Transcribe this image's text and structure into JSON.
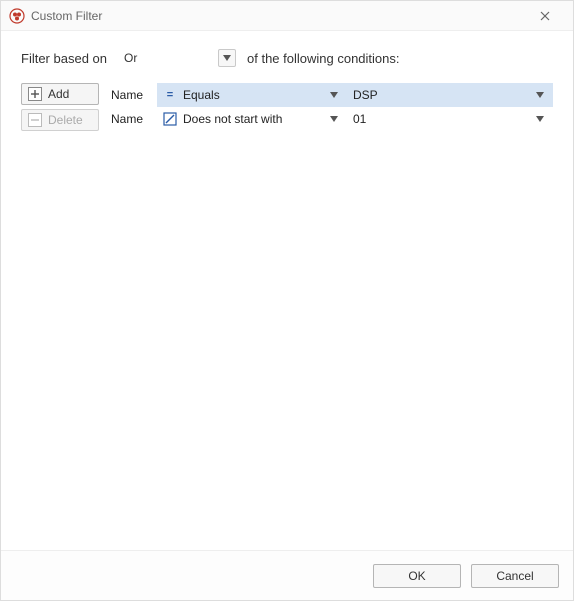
{
  "window": {
    "title": "Custom Filter"
  },
  "filter": {
    "prefix_label": "Filter based on",
    "logic": "Or",
    "suffix_label": "of the following conditions:"
  },
  "side": {
    "add_label": "Add",
    "delete_label": "Delete"
  },
  "rows": [
    {
      "field": "Name",
      "op_icon": "=",
      "op": "Equals",
      "value": "DSP",
      "selected": true
    },
    {
      "field": "Name",
      "op_icon": "✎",
      "op": "Does not start with",
      "value": "01",
      "selected": false
    }
  ],
  "footer": {
    "ok": "OK",
    "cancel": "Cancel"
  }
}
